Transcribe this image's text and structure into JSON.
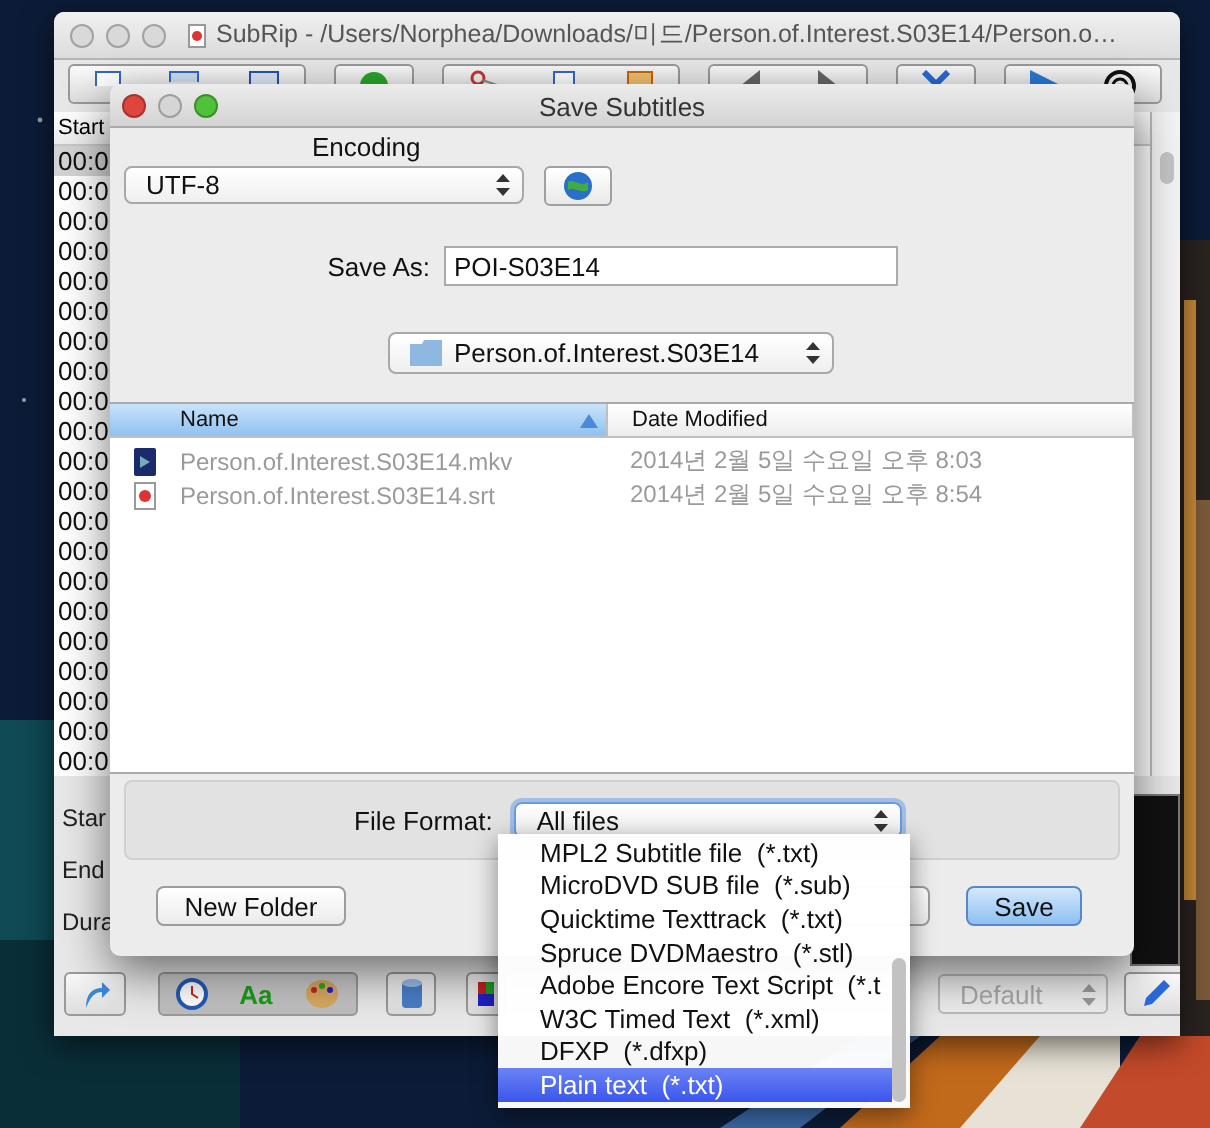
{
  "main_window": {
    "title": "SubRip - /Users/Norphea/Downloads/미드/Person.of.Interest.S03E14/Person.o…",
    "list": {
      "header": "Start",
      "rows": [
        {
          "text": "00:0",
          "selected": true
        },
        {
          "text": "00:0",
          "selected": false
        },
        {
          "text": "00:0",
          "selected": false
        },
        {
          "text": "00:0",
          "selected": false
        },
        {
          "text": "00:0",
          "selected": false
        },
        {
          "text": "00:0",
          "selected": false
        },
        {
          "text": "00:0",
          "selected": false
        },
        {
          "text": "00:0",
          "selected": false
        },
        {
          "text": "00:0",
          "selected": false
        },
        {
          "text": "00:0",
          "selected": false
        },
        {
          "text": "00:0",
          "selected": false
        },
        {
          "text": "00:0",
          "selected": false
        },
        {
          "text": "00:0",
          "selected": false
        },
        {
          "text": "00:0",
          "selected": false
        },
        {
          "text": "00:0",
          "selected": false
        },
        {
          "text": "00:0",
          "selected": false
        },
        {
          "text": "00:0",
          "selected": false
        },
        {
          "text": "00:0",
          "selected": false
        },
        {
          "text": "00:0",
          "selected": false
        },
        {
          "text": "00:0",
          "selected": false
        },
        {
          "text": "00:0",
          "selected": false
        }
      ]
    },
    "info_labels": [
      "Star",
      "End",
      "Dura"
    ],
    "font_button": "Aa",
    "preset": {
      "value": "Default",
      "disabled": true
    }
  },
  "dialog": {
    "title": "Save Subtitles",
    "encoding": {
      "label": "Encoding",
      "value": "UTF-8"
    },
    "save_as": {
      "label": "Save As:",
      "value": "POI-S03E14"
    },
    "folder": "Person.of.Interest.S03E14",
    "browser": {
      "columns": [
        {
          "label": "Name",
          "selected": true
        },
        {
          "label": "Date Modified",
          "selected": false
        }
      ],
      "files": [
        {
          "name": "Person.of.Interest.S03E14.mkv",
          "date": "2014년 2월 5일 수요일 오후 8:03",
          "kind": "video",
          "disabled": true
        },
        {
          "name": "Person.of.Interest.S03E14.srt",
          "date": "2014년 2월 5일 수요일 오후 8:54",
          "kind": "subtitle",
          "disabled": true
        }
      ]
    },
    "file_format": {
      "label": "File Format:",
      "value": "All files"
    },
    "new_folder": "New Folder",
    "save": "Save"
  },
  "format_menu": [
    {
      "label": "MPL2 Subtitle file  (*.txt)",
      "selected": false
    },
    {
      "label": "MicroDVD SUB file  (*.sub)",
      "selected": false
    },
    {
      "label": "Quicktime Texttrack  (*.txt)",
      "selected": false
    },
    {
      "label": "Spruce DVDMaestro  (*.stl)",
      "selected": false
    },
    {
      "label": "Adobe Encore Text Script  (*.t",
      "selected": false
    },
    {
      "label": "W3C Timed Text  (*.xml)",
      "selected": false
    },
    {
      "label": "DFXP  (*.dfxp)",
      "selected": false
    },
    {
      "label": "Plain text  (*.txt)",
      "selected": true
    }
  ]
}
